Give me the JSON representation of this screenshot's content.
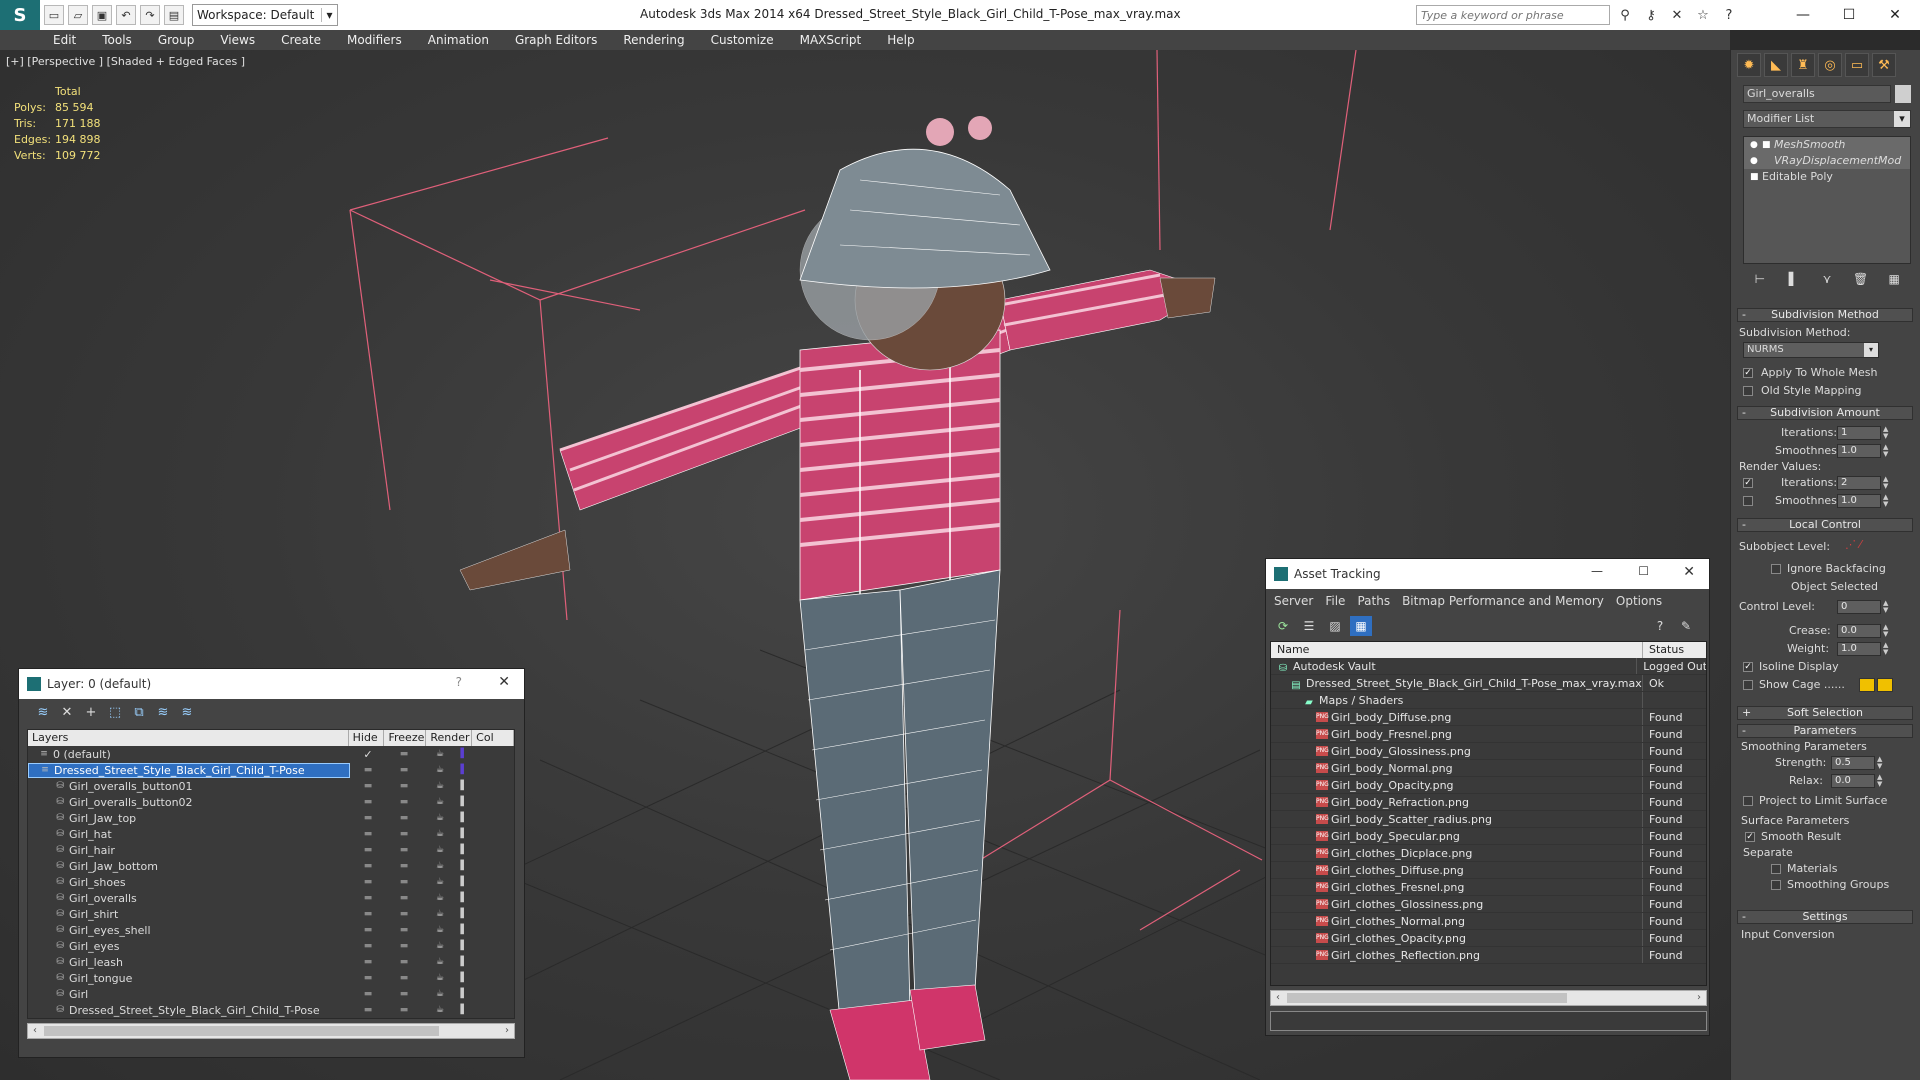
{
  "app": {
    "title": "Autodesk 3ds Max  2014 x64     Dressed_Street_Style_Black_Girl_Child_T-Pose_max_vray.max",
    "workspace": "Workspace: Default",
    "search_placeholder": "Type a keyword or phrase"
  },
  "menu": [
    "Edit",
    "Tools",
    "Group",
    "Views",
    "Create",
    "Modifiers",
    "Animation",
    "Graph Editors",
    "Rendering",
    "Customize",
    "MAXScript",
    "Help"
  ],
  "viewport": {
    "label": "[+] [Perspective ] [Shaded + Edged Faces ]",
    "stats": {
      "header": "Total",
      "rows": [
        {
          "k": "Polys:",
          "v": "85 594"
        },
        {
          "k": "Tris:",
          "v": "171 188"
        },
        {
          "k": "Edges:",
          "v": "194 898"
        },
        {
          "k": "Verts:",
          "v": "109 772"
        }
      ]
    }
  },
  "command_panel": {
    "object_name": "Girl_overalls",
    "modifier_list": "Modifier List",
    "stack": [
      "MeshSmooth",
      "VRayDisplacementMod",
      "Editable Poly"
    ],
    "rollouts": {
      "subdiv_method": "Subdivision Method",
      "subdiv_method_label": "Subdivision Method:",
      "method_value": "NURMS",
      "apply_whole": "Apply To Whole Mesh",
      "old_style": "Old Style Mapping",
      "subdiv_amount": "Subdivision Amount",
      "iterations": "Iterations:",
      "iterations_val": "1",
      "smoothness": "Smoothness:",
      "smoothness_val": "1.0",
      "render_values": "Render Values:",
      "r_iterations_val": "2",
      "r_smoothness_val": "1.0",
      "local_control": "Local Control",
      "subobject_level": "Subobject Level:",
      "ignore_backfacing": "Ignore Backfacing",
      "object_selected": "Object Selected",
      "control_level": "Control Level:",
      "control_level_val": "0",
      "crease": "Crease:",
      "crease_val": "0.0",
      "weight": "Weight:",
      "weight_val": "1.0",
      "isoline": "Isoline Display",
      "show_cage": "Show Cage ......",
      "soft_selection": "Soft Selection",
      "parameters": "Parameters",
      "smoothing_params": "Smoothing Parameters",
      "strength": "Strength:",
      "strength_val": "0.5",
      "relax": "Relax:",
      "relax_val": "0.0",
      "project_limit": "Project to Limit Surface",
      "surface_params": "Surface Parameters",
      "smooth_result": "Smooth Result",
      "separate": "Separate",
      "materials": "Materials",
      "smoothing_groups": "Smoothing Groups",
      "settings": "Settings",
      "input_conversion": "Input Conversion"
    }
  },
  "layer_window": {
    "title": "Layer: 0 (default)",
    "columns": [
      "Layers",
      "Hide",
      "Freeze",
      "Render",
      "Col"
    ],
    "rows": [
      {
        "name": "0 (default)",
        "indent": 1,
        "sel": false
      },
      {
        "name": "Dressed_Street_Style_Black_Girl_Child_T-Pose",
        "indent": 1,
        "sel": true
      },
      {
        "name": "Girl_overalls_button01",
        "indent": 2,
        "sel": false
      },
      {
        "name": "Girl_overalls_button02",
        "indent": 2,
        "sel": false
      },
      {
        "name": "Girl_Jaw_top",
        "indent": 2,
        "sel": false
      },
      {
        "name": "Girl_hat",
        "indent": 2,
        "sel": false
      },
      {
        "name": "Girl_hair",
        "indent": 2,
        "sel": false
      },
      {
        "name": "Girl_Jaw_bottom",
        "indent": 2,
        "sel": false
      },
      {
        "name": "Girl_shoes",
        "indent": 2,
        "sel": false
      },
      {
        "name": "Girl_overalls",
        "indent": 2,
        "sel": false
      },
      {
        "name": "Girl_shirt",
        "indent": 2,
        "sel": false
      },
      {
        "name": "Girl_eyes_shell",
        "indent": 2,
        "sel": false
      },
      {
        "name": "Girl_eyes",
        "indent": 2,
        "sel": false
      },
      {
        "name": "Girl_leash",
        "indent": 2,
        "sel": false
      },
      {
        "name": "Girl_tongue",
        "indent": 2,
        "sel": false
      },
      {
        "name": "Girl",
        "indent": 2,
        "sel": false
      },
      {
        "name": "Dressed_Street_Style_Black_Girl_Child_T-Pose",
        "indent": 2,
        "sel": false
      }
    ]
  },
  "asset_window": {
    "title": "Asset Tracking",
    "menu": [
      "Server",
      "File",
      "Paths",
      "Bitmap Performance and Memory",
      "Options"
    ],
    "columns": [
      "Name",
      "Status"
    ],
    "rows": [
      {
        "name": "Autodesk Vault",
        "status": "Logged Out",
        "indent": 1,
        "kind": "vault"
      },
      {
        "name": "Dressed_Street_Style_Black_Girl_Child_T-Pose_max_vray.max",
        "status": "Ok",
        "indent": 2,
        "kind": "max"
      },
      {
        "name": "Maps / Shaders",
        "status": "",
        "indent": 3,
        "kind": "folder"
      },
      {
        "name": "Girl_body_Diffuse.png",
        "status": "Found",
        "indent": 4,
        "kind": "png"
      },
      {
        "name": "Girl_body_Fresnel.png",
        "status": "Found",
        "indent": 4,
        "kind": "png"
      },
      {
        "name": "Girl_body_Glossiness.png",
        "status": "Found",
        "indent": 4,
        "kind": "png"
      },
      {
        "name": "Girl_body_Normal.png",
        "status": "Found",
        "indent": 4,
        "kind": "png"
      },
      {
        "name": "Girl_body_Opacity.png",
        "status": "Found",
        "indent": 4,
        "kind": "png"
      },
      {
        "name": "Girl_body_Refraction.png",
        "status": "Found",
        "indent": 4,
        "kind": "png"
      },
      {
        "name": "Girl_body_Scatter_radius.png",
        "status": "Found",
        "indent": 4,
        "kind": "png"
      },
      {
        "name": "Girl_body_Specular.png",
        "status": "Found",
        "indent": 4,
        "kind": "png"
      },
      {
        "name": "Girl_clothes_Dicplace.png",
        "status": "Found",
        "indent": 4,
        "kind": "png"
      },
      {
        "name": "Girl_clothes_Diffuse.png",
        "status": "Found",
        "indent": 4,
        "kind": "png"
      },
      {
        "name": "Girl_clothes_Fresnel.png",
        "status": "Found",
        "indent": 4,
        "kind": "png"
      },
      {
        "name": "Girl_clothes_Glossiness.png",
        "status": "Found",
        "indent": 4,
        "kind": "png"
      },
      {
        "name": "Girl_clothes_Normal.png",
        "status": "Found",
        "indent": 4,
        "kind": "png"
      },
      {
        "name": "Girl_clothes_Opacity.png",
        "status": "Found",
        "indent": 4,
        "kind": "png"
      },
      {
        "name": "Girl_clothes_Reflection.png",
        "status": "Found",
        "indent": 4,
        "kind": "png"
      }
    ]
  },
  "colors": {
    "accent": "#2f6fc1",
    "stats": "#f2e07a",
    "shirt": "#c8436f"
  }
}
